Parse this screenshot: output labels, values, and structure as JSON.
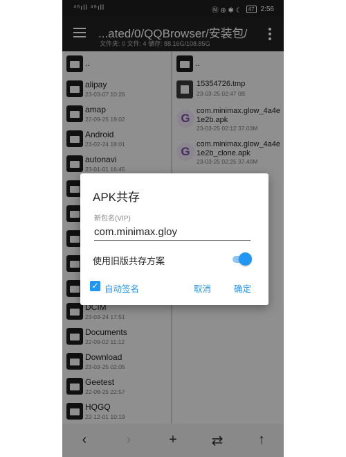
{
  "status_bar": {
    "signal": "⁴⁶ıll ⁴⁶ıll",
    "indicators": "Ⓝ ⊕ ✱ ☾",
    "battery": "47",
    "time": "2:56"
  },
  "app_bar": {
    "title": "...ated/0/QQBrowser/安装包/",
    "subtitle": "文件夹: 0   文件: 4   储存: 88.16G/108.85G",
    "menu_icon": "hamburger-menu-icon",
    "more_icon": "more-vert-icon"
  },
  "left_pane": {
    "items": [
      {
        "name": "..",
        "date": ""
      },
      {
        "name": "alipay",
        "date": "23-03-07 10:26"
      },
      {
        "name": "amap",
        "date": "22-09-25 19:02"
      },
      {
        "name": "Android",
        "date": "23-02-24 18:01"
      },
      {
        "name": "autonavi",
        "date": "23-01-01 16:45"
      },
      {
        "name": "DCIM",
        "date": "23-03-24 17:51"
      },
      {
        "name": "Documents",
        "date": "22-09-02 11:12"
      },
      {
        "name": "Download",
        "date": "23-03-25 02:05"
      },
      {
        "name": "Geetest",
        "date": "22-08-25 22:57"
      },
      {
        "name": "HQGQ",
        "date": "22-12-01 10:19"
      }
    ]
  },
  "right_pane": {
    "items": [
      {
        "name": "..",
        "meta": ""
      },
      {
        "name": "15354726.tmp",
        "meta": "23-03-25 02:47  0B"
      },
      {
        "name": "com.minimax.glow_4a4e1e2b.apk",
        "meta": "23-03-25 02:12  37.03M"
      },
      {
        "name": "com.minimax.glow_4a4e1e2b_clone.apk",
        "meta": "23-03-25 02:25  37.40M"
      }
    ]
  },
  "dialog": {
    "title": "APK共存",
    "field_label": "新包名(VIP)",
    "field_value": "com.minimax.gloy",
    "switch_label": "使用旧版共存方案",
    "switch_on": true,
    "checkbox_label": "自动签名",
    "checkbox_checked": true,
    "cancel_label": "取消",
    "confirm_label": "确定"
  },
  "bottom_bar": {
    "back": "‹",
    "forward": "›",
    "add": "+",
    "swap": "⇄",
    "up": "↑"
  },
  "colors": {
    "accent": "#2196f3",
    "appbar": "#212121"
  }
}
